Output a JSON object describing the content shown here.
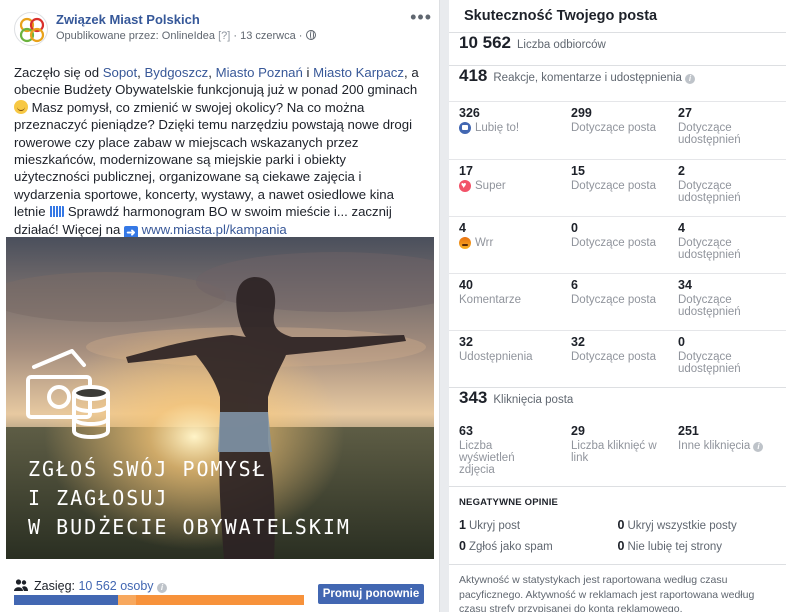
{
  "post": {
    "page_name": "Związek Miast Polskich",
    "published_prefix": "Opublikowane przez:",
    "publisher": "OnlineIdea",
    "publisher_hint": "[?]",
    "date": "· 13 czerwca ·",
    "text_p1": "Zaczęło się od ",
    "link_sopot": "Sopot",
    "sep1": ", ",
    "link_bydgoszcz": "Bydgoszcz",
    "sep2": ", ",
    "link_poznan": "Miasto Poznań",
    "sep3": " i ",
    "link_karpacz": "Miasto Karpacz",
    "text_p2": ", a obecnie Budżety Obywatelskie funkcjonują już w ponad 200 gminach ",
    "text_p3": " Masz pomysł, co zmienić w swojej okolicy? Na co można przeznaczyć pieniądze? Dzięki temu narzędziu powstają nowe drogi rowerowe czy place zabaw w miejscach wskazanych przez mieszkańców, modernizowane są miejskie parki i obiekty użyteczności publicznej, organizowane są ciekawe zajęcia i wydarzenia sportowe, koncerty, wystawy, a nawet osiedlowe kina letnie ",
    "text_p4": " Sprawdź harmonogram BO w swoim mieście i... zacznij działać! Więcej na ",
    "link_url": "www.miasta.pl/kampania",
    "overlay_line1": "ZGŁOŚ SWÓJ POMYSŁ",
    "overlay_line2": "I ZAGŁOSUJ",
    "overlay_line3": "W BUDŻECIE OBYWATELSKIM",
    "reach_label": "Zasięg:",
    "reach_value": "10 562 osoby",
    "reach_organic_fraction": 0.36,
    "reach_paid_fraction": 0.06,
    "promote_label": "Promuj ponownie"
  },
  "stats": {
    "title": "Skuteczność Twojego posta",
    "recipients_num": "10 562",
    "recipients_label": "Liczba odbiorców",
    "reactions_num": "418",
    "reactions_label": "Reakcje, komentarze i udostępnienia",
    "rows": [
      {
        "n1": "326",
        "l1": "Lubię to!",
        "icon": "like-icon",
        "n2": "299",
        "l2": "Dotyczące posta",
        "n3": "27",
        "l3": "Dotyczące udostępnień"
      },
      {
        "n1": "17",
        "l1": "Super",
        "icon": "love-icon",
        "n2": "15",
        "l2": "Dotyczące posta",
        "n3": "2",
        "l3": "Dotyczące udostępnień"
      },
      {
        "n1": "4",
        "l1": "Wrr",
        "icon": "angry-icon",
        "n2": "0",
        "l2": "Dotyczące posta",
        "n3": "4",
        "l3": "Dotyczące udostępnień"
      },
      {
        "n1": "40",
        "l1": "Komentarze",
        "n2": "6",
        "l2": "Dotyczące posta",
        "n3": "34",
        "l3": "Dotyczące udostępnień"
      },
      {
        "n1": "32",
        "l1": "Udostępnienia",
        "n2": "32",
        "l2": "Dotyczące posta",
        "n3": "0",
        "l3": "Dotyczące udostępnień"
      }
    ],
    "clicks_num": "343",
    "clicks_label": "Kliknięcia posta",
    "clicks": [
      {
        "num": "63",
        "label": "Liczba wyświetleń zdjęcia"
      },
      {
        "num": "29",
        "label": "Liczba kliknięć w link"
      },
      {
        "num": "251",
        "label": "Inne kliknięcia"
      }
    ],
    "negative_title": "NEGATYWNE OPINIE",
    "negative": [
      {
        "num": "1",
        "label": "Ukryj post"
      },
      {
        "num": "0",
        "label": "Ukryj wszystkie posty"
      },
      {
        "num": "0",
        "label": "Zgłoś jako spam"
      },
      {
        "num": "0",
        "label": "Nie lubię tej strony"
      }
    ],
    "footnote": "Aktywność w statystykach jest raportowana według czasu pacyficznego. Aktywność w reklamach jest raportowana według czasu strefy przypisanej do konta reklamowego."
  }
}
